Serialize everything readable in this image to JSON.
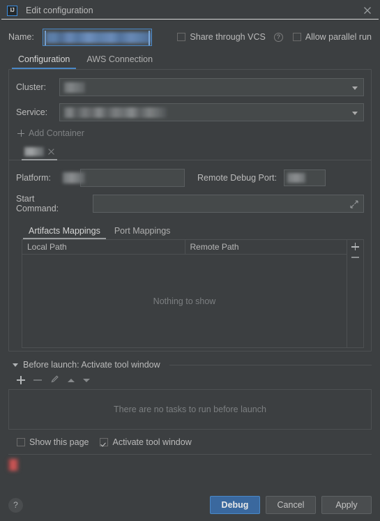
{
  "window": {
    "title": "Edit configuration",
    "app_icon": "intellij-idea-logo-icon",
    "close_icon": "close-icon"
  },
  "name_row": {
    "label": "Name:",
    "value": "",
    "share_vcs": {
      "label": "Share through VCS",
      "checked": false
    },
    "help_icon": "question-mark-icon",
    "allow_parallel": {
      "label": "Allow parallel run",
      "checked": false
    }
  },
  "main_tabs": [
    {
      "label": "Configuration",
      "active": true
    },
    {
      "label": "AWS Connection",
      "active": false
    }
  ],
  "config": {
    "cluster": {
      "label": "Cluster:",
      "value": ""
    },
    "service": {
      "label": "Service:",
      "value": ""
    },
    "add_container": {
      "label": "Add Container",
      "icon": "plus-icon"
    },
    "container_tabs": [
      {
        "label": "",
        "active": true,
        "close_icon": "close-icon"
      }
    ],
    "platform": {
      "label": "Platform:",
      "value": ""
    },
    "remote_debug_port": {
      "label": "Remote Debug Port:",
      "value": ""
    },
    "start_command": {
      "label": "Start Command:",
      "value": "",
      "expand_icon": "expand-icon"
    },
    "mapping_tabs": [
      {
        "label": "Artifacts Mappings",
        "active": true
      },
      {
        "label": "Port Mappings",
        "active": false
      }
    ],
    "table": {
      "columns": [
        "Local Path",
        "Remote Path"
      ],
      "rows": [],
      "empty_text": "Nothing to show",
      "add_icon": "plus-icon",
      "remove_icon": "minus-icon"
    }
  },
  "before_launch": {
    "title": "Before launch: Activate tool window",
    "collapse_icon": "triangle-down-icon",
    "toolbar": [
      {
        "icon": "plus-icon",
        "enabled": true
      },
      {
        "icon": "minus-icon",
        "enabled": false
      },
      {
        "icon": "pencil-icon",
        "enabled": false
      },
      {
        "icon": "arrow-up-icon",
        "enabled": false
      },
      {
        "icon": "arrow-down-icon",
        "enabled": false
      }
    ],
    "empty_text": "There are no tasks to run before launch"
  },
  "bottom": {
    "show_this_page": {
      "label": "Show this page",
      "checked": false
    },
    "activate_tool_window": {
      "label": "Activate tool window",
      "checked": true
    },
    "error_message": "",
    "help_icon": "question-mark-icon",
    "buttons": [
      {
        "label": "Debug",
        "primary": true
      },
      {
        "label": "Cancel",
        "primary": false
      },
      {
        "label": "Apply",
        "primary": false
      }
    ]
  },
  "colors": {
    "background": "#3c3f41",
    "accent_blue": "#4a88c7",
    "primary_button": "#3a689e",
    "field_background": "#45494a",
    "border": "#4d5052",
    "text": "#bbbbbb",
    "muted_text": "#7c7f81",
    "error_red": "#d85c5c"
  }
}
